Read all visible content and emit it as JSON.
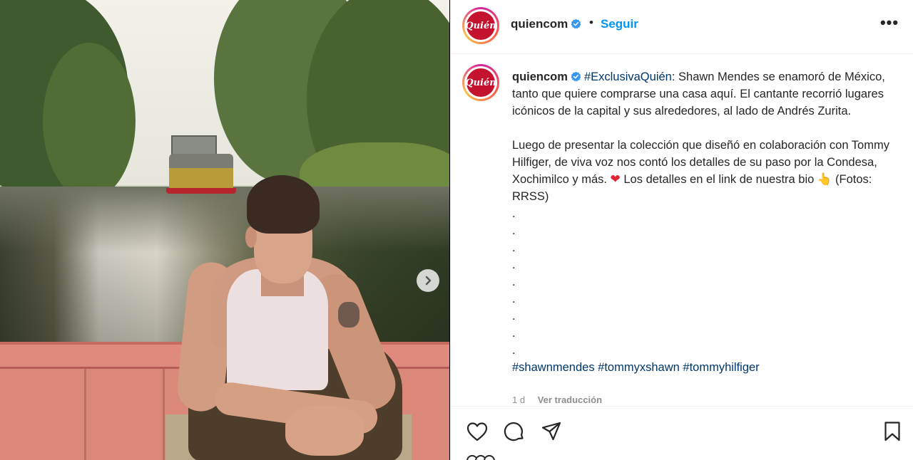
{
  "post": {
    "username": "quiencom",
    "avatar_text": "Quién",
    "follow_label": "Seguir",
    "dot": "•",
    "more_label": "•••",
    "caption": {
      "username": "quiencom",
      "hashtag_lead": "#ExclusivaQuién",
      "p1_rest": ": Shawn Mendes se enamoró de México, tanto que quiere comprarse una casa aquí. El cantante recorrió lugares icónicos de la capital y sus alrededores, al lado de Andrés Zurita.",
      "p2_a": "Luego de presentar la colección que diseñó en colaboración con Tommy Hilfiger, de viva voz nos contó los detalles de su paso por la Condesa, Xochimilco y más. ",
      "p2_heart": "❤",
      "p2_b": " Los detalles en el link de nuestra bio ",
      "p2_hand": "👆",
      "p2_c": " (Fotos: RRSS)",
      "dots": [
        ".",
        ".",
        ".",
        ".",
        ".",
        ".",
        ".",
        ".",
        "."
      ],
      "hashtags": [
        "#shawnmendes",
        "#tommyxshawn",
        "#tommyhilfiger"
      ],
      "time": "1 d",
      "translate_label": "Ver traducción"
    }
  },
  "icons": {
    "verified": "verified-badge-icon",
    "next": "chevron-right-icon",
    "like": "heart-icon",
    "comment": "comment-icon",
    "share": "share-icon",
    "save": "bookmark-icon"
  },
  "colors": {
    "follow": "#0095f6",
    "verified": "#3897f0",
    "hashtag": "#00376b",
    "brand": "#c4122f"
  }
}
